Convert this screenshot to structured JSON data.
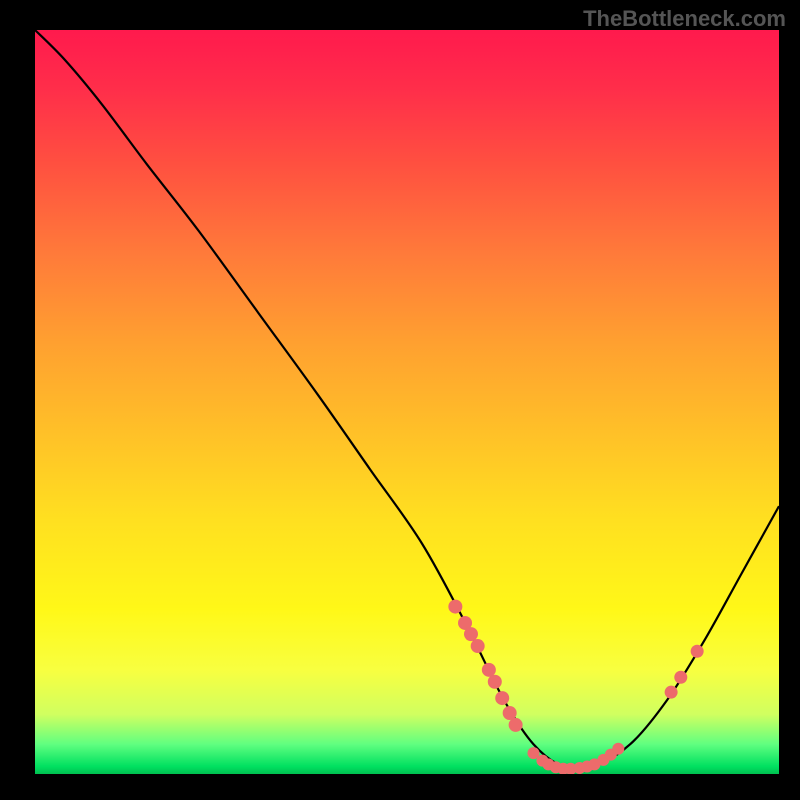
{
  "watermark": "TheBottleneck.com",
  "chart_data": {
    "type": "line",
    "title": "",
    "xlabel": "",
    "ylabel": "",
    "xlim": [
      0,
      100
    ],
    "ylim": [
      0,
      100
    ],
    "curve": {
      "x": [
        0,
        4,
        9,
        15,
        22,
        30,
        38,
        45,
        52,
        58,
        63,
        67,
        71,
        75,
        80,
        85,
        90,
        95,
        100
      ],
      "y": [
        100,
        96,
        90,
        82,
        73,
        62,
        51,
        41,
        31,
        20,
        10,
        4,
        1,
        1,
        4,
        10,
        18,
        27,
        36
      ]
    },
    "markers_left": [
      {
        "x": 56.5,
        "y": 22.5
      },
      {
        "x": 57.8,
        "y": 20.3
      },
      {
        "x": 58.6,
        "y": 18.8
      },
      {
        "x": 59.5,
        "y": 17.2
      },
      {
        "x": 61.0,
        "y": 14.0
      },
      {
        "x": 61.8,
        "y": 12.4
      },
      {
        "x": 62.8,
        "y": 10.2
      },
      {
        "x": 63.8,
        "y": 8.2
      },
      {
        "x": 64.6,
        "y": 6.6
      }
    ],
    "markers_bottom": [
      {
        "x": 67.0,
        "y": 2.8
      },
      {
        "x": 68.2,
        "y": 1.8
      },
      {
        "x": 69.0,
        "y": 1.3
      },
      {
        "x": 70.0,
        "y": 0.9
      },
      {
        "x": 71.0,
        "y": 0.7
      },
      {
        "x": 72.0,
        "y": 0.7
      },
      {
        "x": 73.2,
        "y": 0.8
      },
      {
        "x": 74.2,
        "y": 1.0
      },
      {
        "x": 75.2,
        "y": 1.3
      },
      {
        "x": 76.4,
        "y": 1.9
      },
      {
        "x": 77.4,
        "y": 2.6
      },
      {
        "x": 78.4,
        "y": 3.4
      }
    ],
    "markers_right": [
      {
        "x": 85.5,
        "y": 11.0
      },
      {
        "x": 86.8,
        "y": 13.0
      },
      {
        "x": 89.0,
        "y": 16.5
      }
    ],
    "gradient_stops": [
      {
        "pos": 0,
        "color": "#ff1a4d"
      },
      {
        "pos": 50,
        "color": "#ffc028"
      },
      {
        "pos": 85,
        "color": "#fff818"
      },
      {
        "pos": 100,
        "color": "#00c050"
      }
    ]
  }
}
